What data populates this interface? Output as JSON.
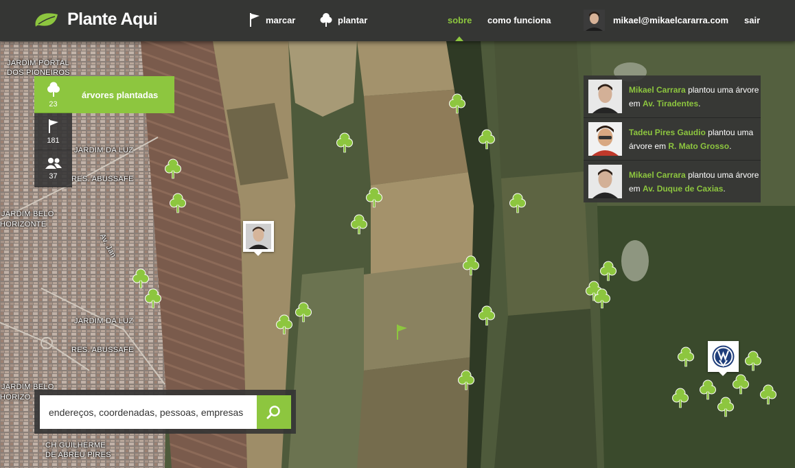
{
  "brand": {
    "name": "Plante Aqui",
    "color": "#8dc63f"
  },
  "nav": {
    "marcar": "marcar",
    "plantar": "plantar",
    "sobre": "sobre",
    "como_funciona": "como funciona",
    "user_email": "mikael@mikaelcararra.com",
    "sair": "sair"
  },
  "stats": [
    {
      "icon": "tree-icon",
      "count": "23"
    },
    {
      "icon": "flag-icon",
      "count": "181"
    },
    {
      "icon": "users-icon",
      "count": "37"
    }
  ],
  "stats_tooltip": "árvores plantadas",
  "feed": [
    {
      "user": "Mikael Carrara",
      "action_1": "plantou uma",
      "action_2": "árvore em",
      "place": "Av. Tiradentes",
      "end": "."
    },
    {
      "user": "Tadeu Pires Gaudio",
      "action_1": "plantou uma",
      "action_2": "árvore em",
      "place": "R. Mato Grosso",
      "end": "."
    },
    {
      "user": "Mikael Carrara",
      "action_1": "plantou uma",
      "action_2": "árvore em",
      "place": "Av. Duque de Caxias",
      "end": "."
    }
  ],
  "search": {
    "placeholder": "endereços, coordenadas, pessoas, empresas"
  },
  "map_labels": {
    "jardim_portal": "JARDIM PORTAL",
    "dos_pioneiros": "DOS PIONEIROS",
    "jardim_da_luz_1": "JARDIM DA LUZ",
    "res_abussafe_1": "RES. ABUSSAFE",
    "jardim_belo": "JARDIM BELO",
    "horizonte_1": "HORIZONTE",
    "av_jan": "Av. Jan",
    "jardim_da_luz_2": "JARDIM DA LUZ",
    "res_abussafe_2": "RES. ABUSSAFE",
    "jardim_belo_2": "JARDIM BELO",
    "horizonte_2": "HORIZO",
    "ch_guilherme": "CH GUILHERME",
    "de_abreu": "DE ABREU PIRES"
  }
}
